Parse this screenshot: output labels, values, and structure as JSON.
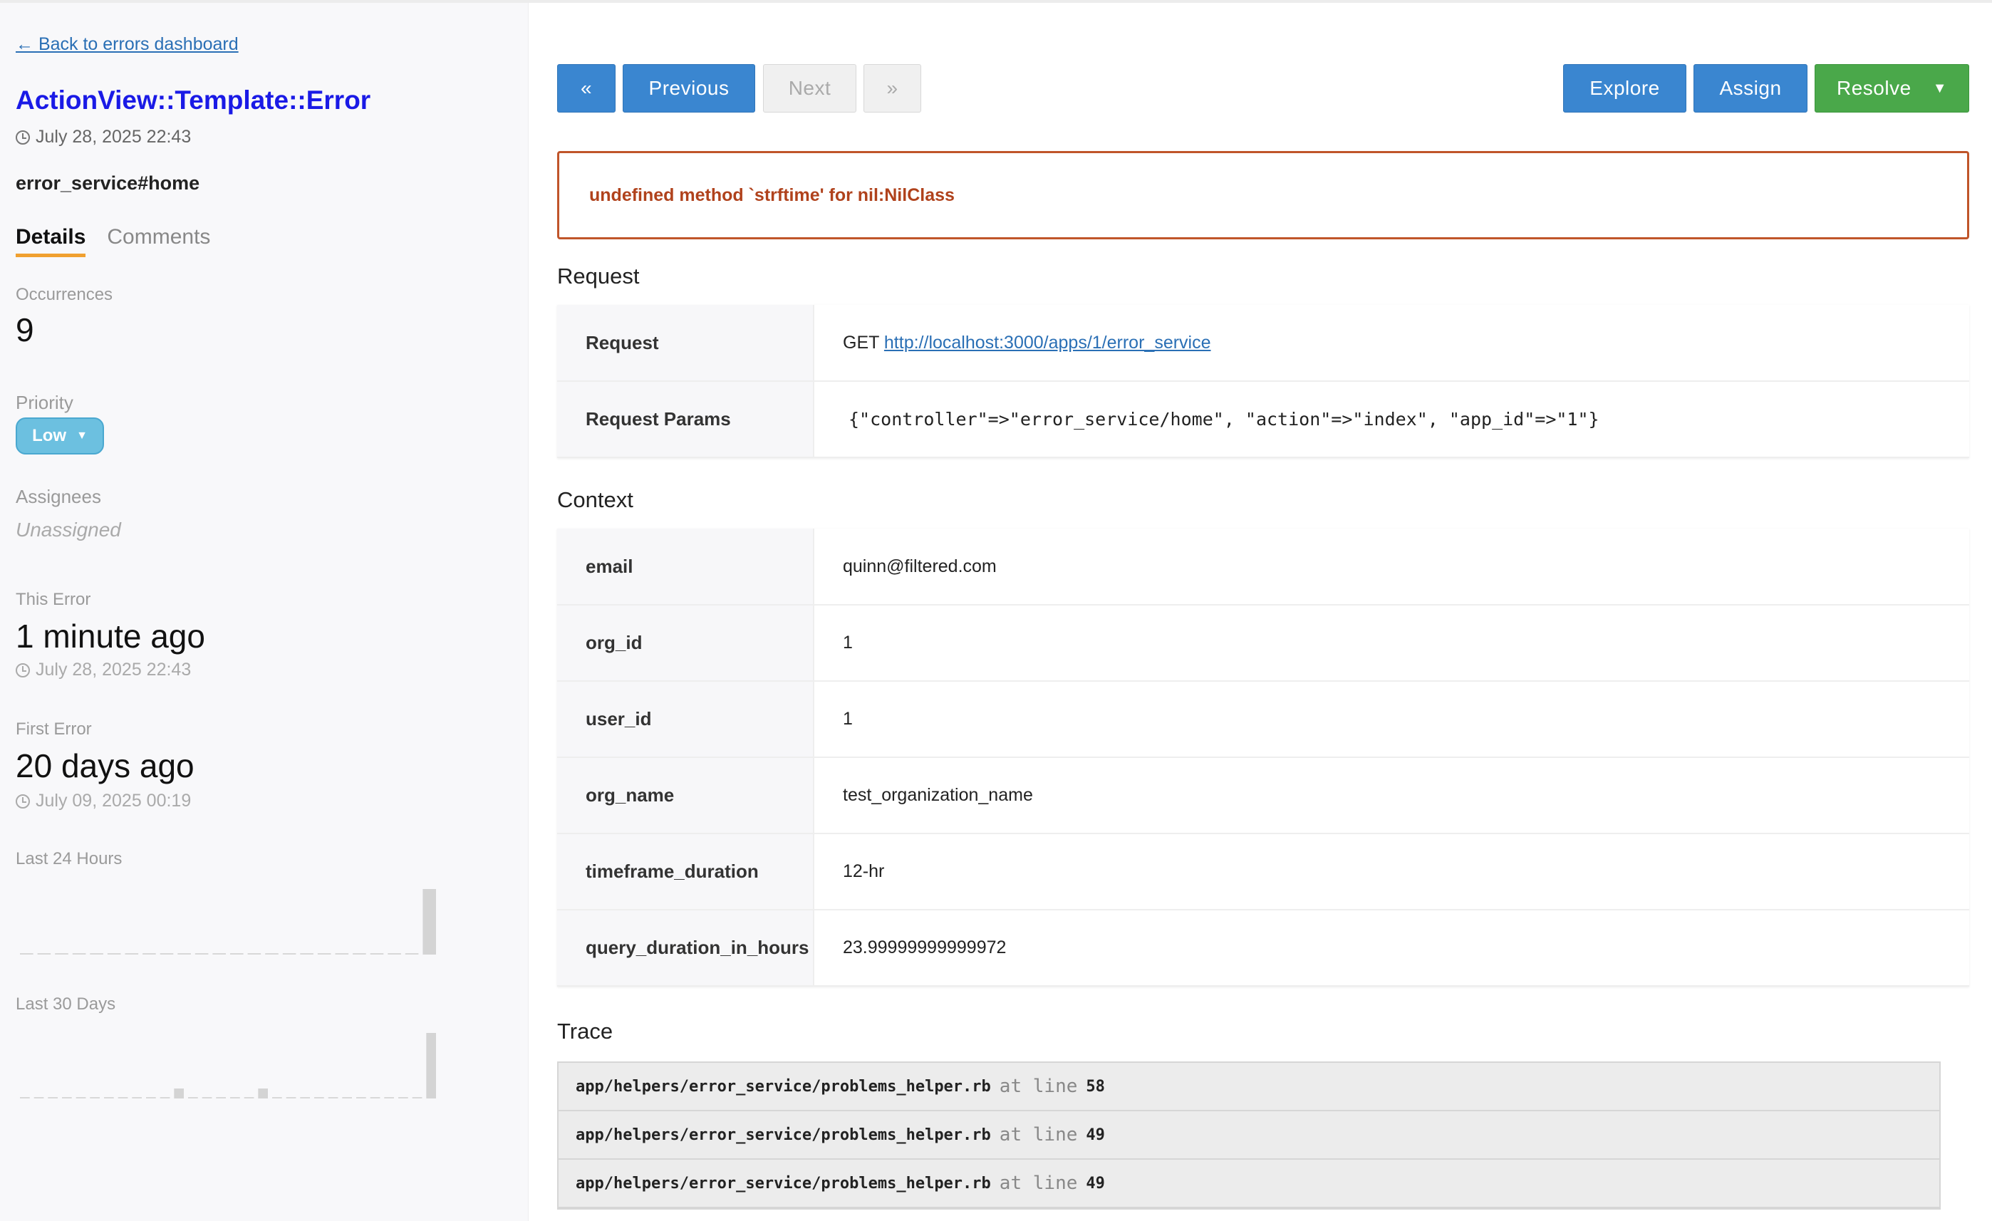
{
  "sidebar": {
    "back_link": "← Back to errors dashboard",
    "error_class": "ActionView::Template::Error",
    "error_time": "July 28, 2025 22:43",
    "route": "error_service#home",
    "tabs": [
      {
        "label": "Details",
        "active": true
      },
      {
        "label": "Comments",
        "active": false
      }
    ],
    "occurrences_label": "Occurrences",
    "occurrences_value": "9",
    "priority_label": "Priority",
    "priority_value": "Low",
    "assignees_label": "Assignees",
    "assignees_value": "Unassigned",
    "this_error_label": "This Error",
    "this_error_relative": "1 minute ago",
    "this_error_time": "July 28, 2025 22:43",
    "first_error_label": "First Error",
    "first_error_relative": "20 days ago",
    "first_error_time": "July 09, 2025 00:19",
    "last24_label": "Last 24 Hours",
    "last24_values": [
      0,
      0,
      0,
      0,
      0,
      0,
      0,
      0,
      0,
      0,
      0,
      0,
      0,
      0,
      0,
      0,
      0,
      0,
      0,
      0,
      0,
      0,
      0,
      9
    ],
    "last30_label": "Last 30 Days",
    "last30_values": [
      0,
      0,
      0,
      0,
      0,
      0,
      0,
      0,
      0,
      0,
      0,
      1,
      0,
      0,
      0,
      0,
      0,
      1,
      0,
      0,
      0,
      0,
      0,
      0,
      0,
      0,
      0,
      0,
      0,
      9
    ]
  },
  "toolbar": {
    "first_label": "«",
    "previous_label": "Previous",
    "next_label": "Next",
    "last_label": "»",
    "explore_label": "Explore",
    "assign_label": "Assign",
    "resolve_label": "Resolve",
    "resolve_caret": "▼"
  },
  "error_message": "undefined method `strftime' for nil:NilClass",
  "request": {
    "heading": "Request",
    "rows": [
      {
        "key": "Request",
        "method": "GET",
        "url": "http://localhost:3000/apps/1/error_service"
      },
      {
        "key": "Request Params",
        "value": "{\"controller\"=>\"error_service/home\", \"action\"=>\"index\", \"app_id\"=>\"1\"}"
      }
    ]
  },
  "context": {
    "heading": "Context",
    "rows": [
      {
        "key": "email",
        "value": "quinn@filtered.com"
      },
      {
        "key": "org_id",
        "value": "1"
      },
      {
        "key": "user_id",
        "value": "1"
      },
      {
        "key": "org_name",
        "value": "test_organization_name"
      },
      {
        "key": "timeframe_duration",
        "value": "12-hr"
      },
      {
        "key": "query_duration_in_hours",
        "value": "23.99999999999972"
      }
    ]
  },
  "trace": {
    "heading": "Trace",
    "at_text": "at line",
    "rows": [
      {
        "file": "app/helpers/error_service/problems_helper.rb",
        "line": "58"
      },
      {
        "file": "app/helpers/error_service/problems_helper.rb",
        "line": "49"
      },
      {
        "file": "app/helpers/error_service/problems_helper.rb",
        "line": "49"
      }
    ]
  },
  "colors": {
    "link": "#2a6fb5",
    "title": "#1a1ae6",
    "primary_button": "#3a86d0",
    "resolve_button": "#4aa84a",
    "error_border": "#c0552a",
    "priority_pill": "#6cc0e0",
    "tab_underline": "#f0a030"
  }
}
